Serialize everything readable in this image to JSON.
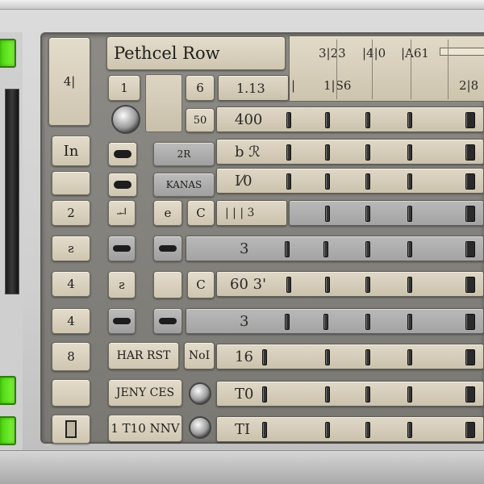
{
  "window": {
    "title": "Pethcel Row"
  },
  "header": {
    "labels": [
      "3|23",
      "|4|0",
      "|A61"
    ],
    "sub_labels": [
      "|",
      "1|S6",
      "2|8"
    ]
  },
  "left_keys": [
    "In",
    "",
    "2",
    "ƨ",
    "4",
    "4",
    "8",
    "",
    ""
  ],
  "top_keys": {
    "big_glyph": "4|",
    "k1": "1",
    "k2": "6",
    "k3": "1.13",
    "k4": "50"
  },
  "mid_keys": {
    "dr": "2R",
    "kanas": "KANAS",
    "e_key": "e",
    "c_key": "C",
    "c2_key": "C",
    "hare": "HAR RST",
    "nol": "NoI",
    "jeny": "JENY CES",
    "ltno": "1 T10 NNV",
    "small_a": "ƨ",
    "small_b": "ᅬ"
  },
  "tracks": [
    {
      "label": "400",
      "style": "tan"
    },
    {
      "label": "b   ℛ",
      "style": "tan"
    },
    {
      "label": "I⁄0",
      "style": "tan"
    },
    {
      "label": "|   |   |   3",
      "style": "tan"
    },
    {
      "label": "3",
      "style": "gray"
    },
    {
      "label": "60  3'",
      "style": "tan"
    },
    {
      "label": "3",
      "style": "gray"
    },
    {
      "label": "16",
      "style": "tan"
    },
    {
      "label": "T0",
      "style": "tan"
    },
    {
      "label": "TI",
      "style": "tan"
    }
  ]
}
